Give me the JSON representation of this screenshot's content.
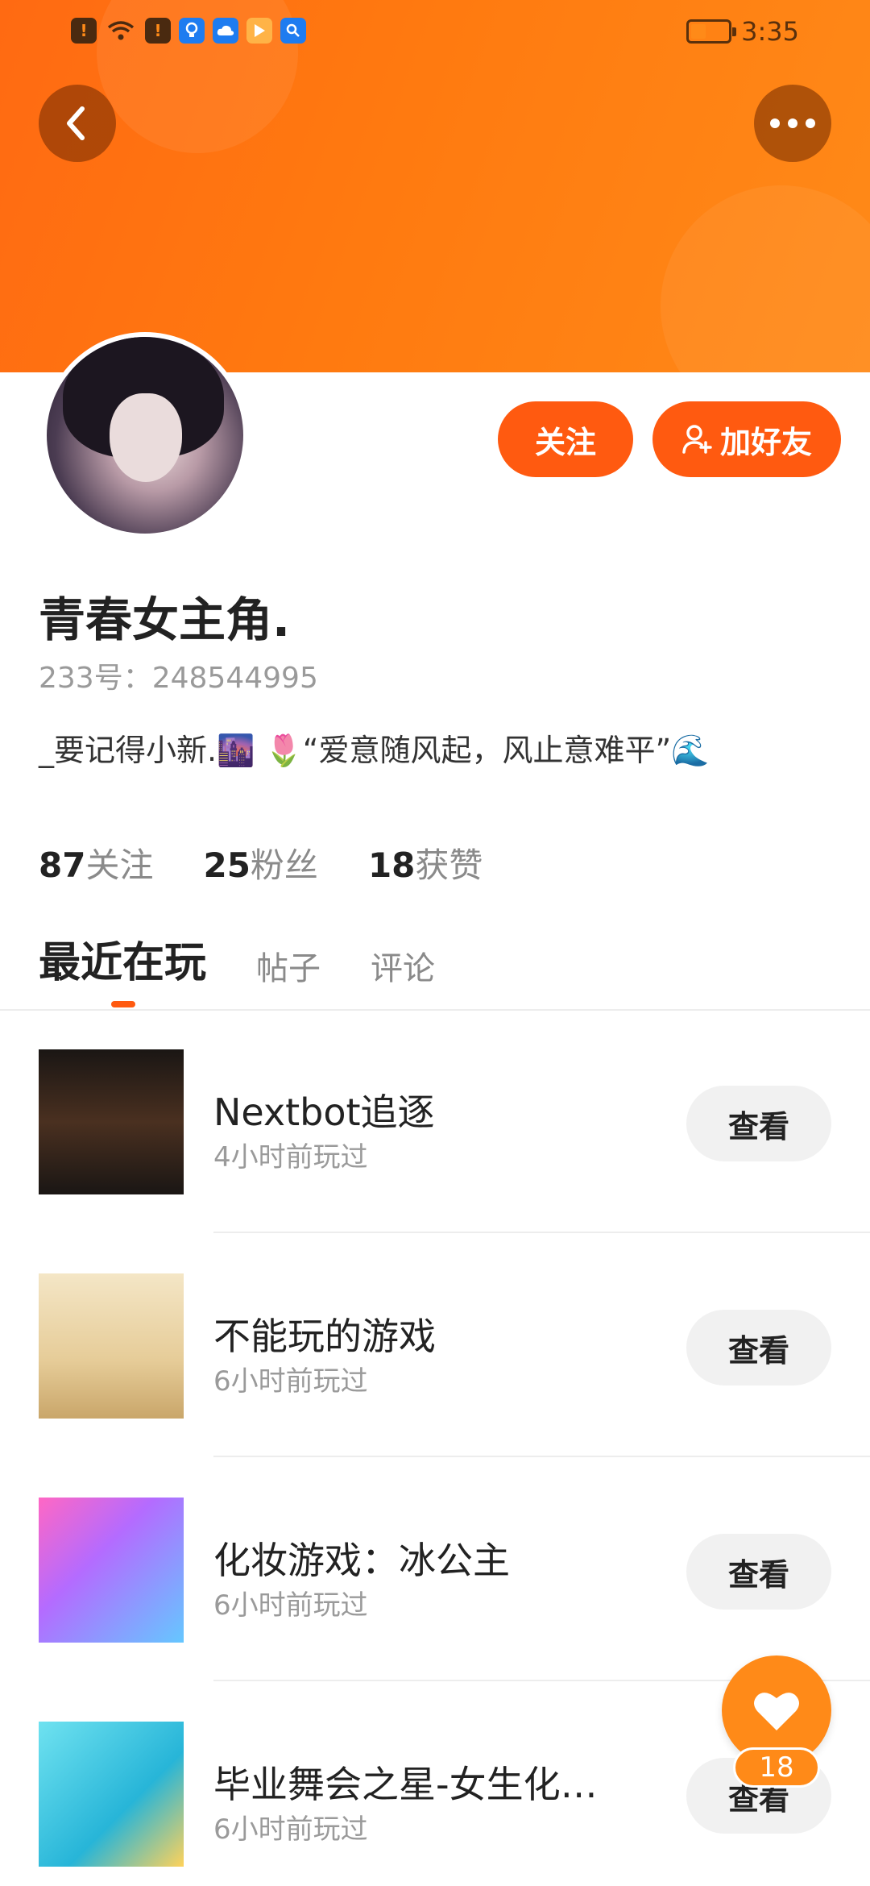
{
  "status_bar": {
    "time": "3:35"
  },
  "profile": {
    "nickname": "青春女主角.",
    "uid": "233号：248544995",
    "bio": "_要记得小新.🌆 🌷“爱意随风起，风止意难平”🌊"
  },
  "actions": {
    "follow": "关注",
    "add_friend": "加好友"
  },
  "stats": [
    {
      "num": "87",
      "label": "关注"
    },
    {
      "num": "25",
      "label": "粉丝"
    },
    {
      "num": "18",
      "label": "获赞"
    }
  ],
  "tabs": [
    {
      "label": "最近在玩",
      "active": true
    },
    {
      "label": "帖子",
      "active": false
    },
    {
      "label": "评论",
      "active": false
    }
  ],
  "games": [
    {
      "title": "Nextbot追逐",
      "time": "4小时前玩过",
      "button": "查看"
    },
    {
      "title": "不能玩的游戏",
      "time": "6小时前玩过",
      "button": "查看"
    },
    {
      "title": "化妆游戏：冰公主",
      "time": "6小时前玩过",
      "button": "查看"
    },
    {
      "title": "毕业舞会之星-女生化…",
      "time": "6小时前玩过",
      "button": "查看"
    }
  ],
  "like_fab": {
    "count": "18"
  },
  "colors": {
    "accent": "#ff5a10",
    "banner": "#ff7a10"
  },
  "icons": {
    "back": "chevron-left-icon",
    "more": "more-horizontal-icon",
    "add_friend": "user-plus-icon",
    "like": "heart-icon"
  }
}
